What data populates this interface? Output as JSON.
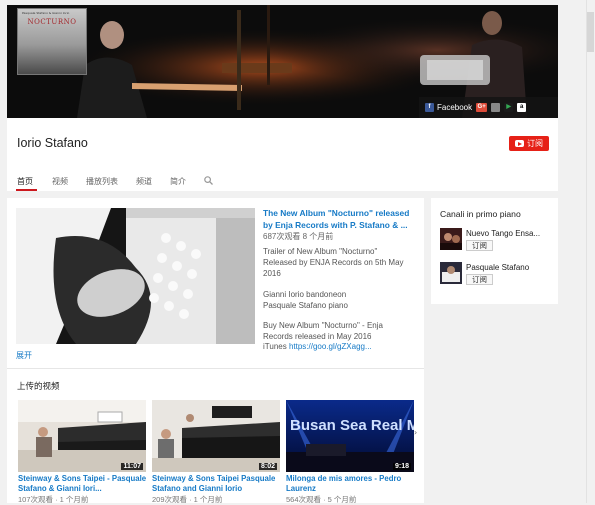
{
  "banner": {
    "album_top_text": "Pasquale Stafano & Gianni Iorio",
    "album_title": "NOCTURNO",
    "social": {
      "facebook_label": "Facebook",
      "gplus_label": "G+",
      "apple_label": "",
      "play_label": "",
      "amazon_label": "a"
    }
  },
  "channel": {
    "name": "Iorio Stafano",
    "subscribe_label": "订阅"
  },
  "tabs": [
    {
      "label": "首页",
      "active": true
    },
    {
      "label": "视频"
    },
    {
      "label": "播放列表"
    },
    {
      "label": "频道"
    },
    {
      "label": "简介"
    }
  ],
  "featured": {
    "title": "The New Album \"Nocturno\" released by Enja Records with P. Stafano & ...",
    "meta": "687次观看  8 个月前",
    "desc_lines": [
      "Trailer of New Album \"Nocturno\"",
      "Released by ENJA Records on 5th May",
      "2016",
      "",
      "Gianni Iorio bandoneon",
      "Pasquale Stafano piano",
      "",
      "Buy New Album \"Nocturno\" - Enja",
      "Records released in May 2016",
      "iTunes "
    ],
    "link": "https://goo.gl/gZXagg...",
    "expand_label": "展开"
  },
  "uploads": {
    "title": "上传的视频",
    "videos": [
      {
        "title": "Steinway & Sons Taipei - Pasquale Stafano & Gianni Iori...",
        "duration": "11:07",
        "meta": "107次观看 · 1 个月前"
      },
      {
        "title": "Steinway & Sons Taipei Pasquale Stafano and Gianni Iorio",
        "duration": "8:02",
        "meta": "209次观看 · 1 个月前"
      },
      {
        "title": "Milonga de mis amores - Pedro Laurenz",
        "duration": "9:18",
        "meta": "564次观看 · 5 个月前",
        "thumb_text": "Busan Sea Real Musi"
      }
    ]
  },
  "sidebar": {
    "title": "Canali in primo piano",
    "channels": [
      {
        "name": "Nuevo Tango Ensa...",
        "subscribe_label": "订阅"
      },
      {
        "name": "Pasquale Stafano",
        "subscribe_label": "订阅"
      }
    ]
  },
  "colors": {
    "accent": "#e62117",
    "link": "#167ac6"
  }
}
